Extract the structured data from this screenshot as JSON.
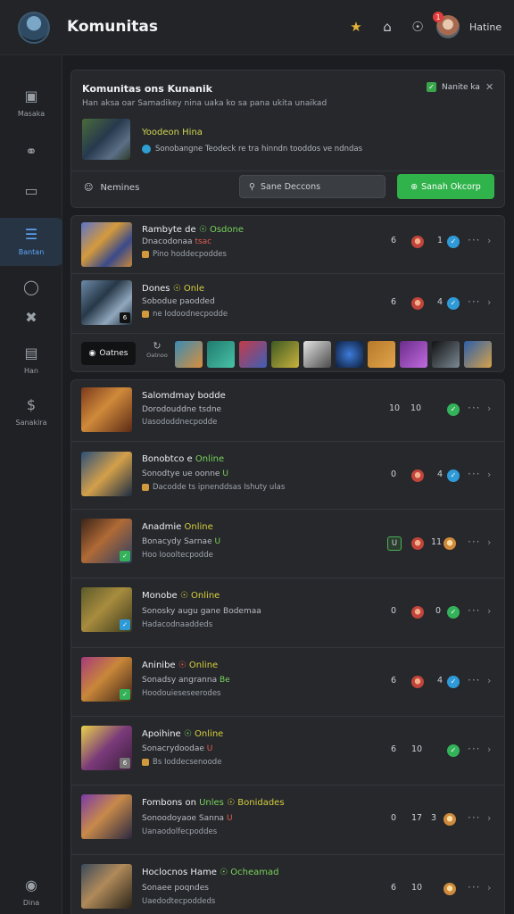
{
  "topbar": {
    "title": "Komunitas",
    "user_name": "Hatine",
    "notif_count": "1",
    "icons": [
      "trophy-icon",
      "home-icon",
      "compass-icon"
    ]
  },
  "sidebar": {
    "items": [
      {
        "label": "Masaka",
        "icon": "chat-icon"
      },
      {
        "label": "",
        "icon": "link-icon"
      },
      {
        "label": "",
        "icon": "monitor-icon"
      },
      {
        "label": "Bantan",
        "icon": "list-icon",
        "active": true
      },
      {
        "label": "",
        "icon": "coin-icon"
      },
      {
        "label": "",
        "icon": "tools-icon"
      },
      {
        "label": "Han",
        "icon": "folder-icon"
      },
      {
        "label": "Sanakira",
        "icon": "dollar-icon"
      },
      {
        "label": "Dina",
        "icon": "gamepad-icon"
      }
    ]
  },
  "header": {
    "title": "Komunitas ons Kunanik",
    "subtitle": "Han aksa oar Samadikey nina uaka ko sa pana ukita unaikad",
    "checkbox_label": "Nanite ka",
    "feature_title": "Yoodeon Hina",
    "feature_sub": "Sonobangne Teodeck re tra hinndn tooddos ve ndndas",
    "members_label": "Nemines",
    "search_placeholder": "Sane Deccons",
    "button_label": "Sanah Okcorp"
  },
  "group1": {
    "rows": [
      {
        "title": "Rambyte de",
        "status": "Osdone",
        "status_class": "",
        "line2": "Dnacodonaa",
        "line2_hl": "tsac",
        "line3": "Pino hoddecpoddes",
        "stat1": "6",
        "stat2": "1",
        "r1": "red",
        "r2": "blue"
      },
      {
        "title": "Dones",
        "status": "Onle",
        "status_class": "yellow",
        "line2": "Sobodue paodded",
        "line2_hl": "",
        "line3": "ne Iodoodnecpodde",
        "stat1": "6",
        "stat2": "4",
        "r1": "red",
        "r2": "blue"
      }
    ],
    "games_label": "Oatnes",
    "refresh_label": "Oatnoo"
  },
  "group2": {
    "rows": [
      {
        "title": "Salomdmay",
        "status": "bodde",
        "status_class": "white",
        "line2": "Dorodouddne tsdne",
        "line2_hl": "",
        "line3": "Uasododdnecpodde",
        "stat1": "10",
        "stat2": "10",
        "r1": "",
        "r2": "green"
      },
      {
        "title": "Bonobtco e",
        "status": "Online",
        "status_class": "",
        "line2": "Sonodtye ue oonne",
        "line2_hl": "U",
        "line3": "Dacodde ts ipnenddsas Ishuty ulas",
        "stat1": "0",
        "stat2": "4",
        "r1": "red",
        "r2": "blue"
      },
      {
        "title": "Anadmie",
        "status": "Online",
        "status_class": "yellow",
        "line2": "Bonacydy Sarnae",
        "line2_hl": "U",
        "line3": "Hoo Ioooltecpodde",
        "stat1": "U",
        "stat2": "11",
        "r1": "red",
        "r2": "orange",
        "boxed": true
      },
      {
        "title": "Monobe",
        "status": "Online",
        "status_class": "yellow",
        "line2": "Sonosky augu gane Bodemaa",
        "line2_hl": "",
        "line3": "Hadacodnaaddeds",
        "stat1": "0",
        "stat2": "0",
        "r1": "red",
        "r2": "green"
      },
      {
        "title": "Aninibe",
        "status": "Online",
        "status_class": "",
        "line2": "Sonadsy angranna",
        "line2_hl": "Be",
        "line3": "Hoodouieseseerodes",
        "stat1": "6",
        "stat2": "4",
        "r1": "red",
        "r2": "blue"
      },
      {
        "title": "Apoihine",
        "status": "Online",
        "status_class": "",
        "line2": "Sonacrydoodae",
        "line2_hl": "U",
        "line3": "Bs Ioddecsenoode",
        "stat1": "6",
        "stat2": "10",
        "r1": "",
        "r2": "green"
      },
      {
        "title": "Fombons on",
        "status": "Unles",
        "status_class": "",
        "line2": "Sonoodoyaoe Sanna",
        "line2_hl": "U",
        "line3": "Uanaodolfecpoddes",
        "stat1": "0",
        "stat2": "17",
        "r1": "",
        "r2": "orange",
        "extra": "Bonidades"
      },
      {
        "title": "Hoclocnos Hame",
        "status": "Ocheamad",
        "status_class": "",
        "line2": "Sonaee poqndes",
        "line2_hl": "",
        "line3": "Uaedodtecpoddeds",
        "stat1": "6",
        "stat2": "10",
        "r1": "",
        "r2": "orange"
      }
    ]
  },
  "colors": {
    "accent": "#2fb34a",
    "active": "#5ea8ff",
    "background": "#1b1d20",
    "panel": "#26282c"
  }
}
